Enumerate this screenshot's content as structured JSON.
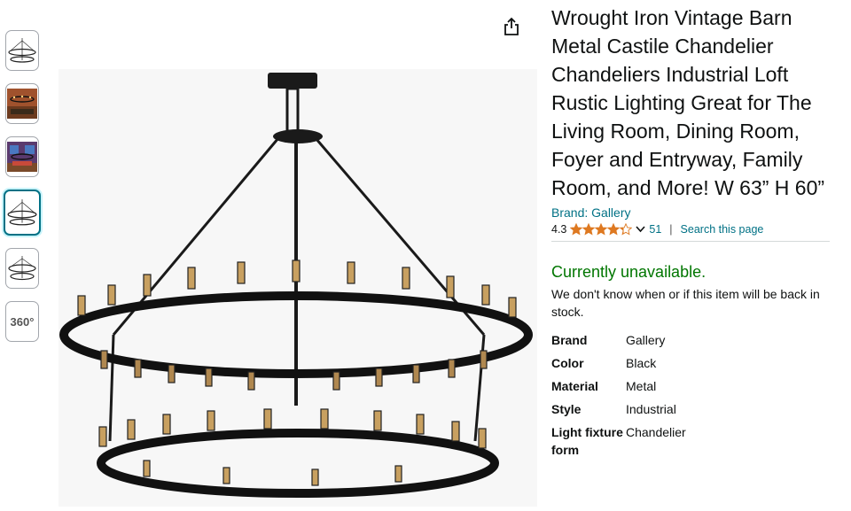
{
  "thumbnails": [
    {
      "name": "thumb-chandelier-1",
      "selected": false
    },
    {
      "name": "thumb-room-scene-1",
      "selected": false
    },
    {
      "name": "thumb-room-scene-2",
      "selected": false
    },
    {
      "name": "thumb-chandelier-2",
      "selected": true
    },
    {
      "name": "thumb-chandelier-3",
      "selected": false
    },
    {
      "name": "thumb-360",
      "selected": false
    }
  ],
  "thumb_360_label": "360°",
  "share_icon": "share-icon",
  "product": {
    "title": "Wrought Iron Vintage Barn Metal Castile Chandelier Chandeliers Industrial Loft Rustic Lighting Great for The Living Room, Dining Room, Foyer and Entryway, Family Room, and More! W 63” H 60”",
    "brand_link": "Brand: Gallery",
    "rating": "4.3",
    "rating_value": 4.3,
    "rating_max": 5,
    "review_count": "51",
    "separator": "|",
    "search_link": "Search this page",
    "availability": "Currently unavailable.",
    "availability_note": "We don't know when or if this item will be back in stock."
  },
  "specs": [
    {
      "key": "Brand",
      "value": "Gallery"
    },
    {
      "key": "Color",
      "value": "Black"
    },
    {
      "key": "Material",
      "value": "Metal"
    },
    {
      "key": "Style",
      "value": "Industrial"
    },
    {
      "key": "Light fixture form",
      "value": "Chandelier"
    }
  ],
  "colors": {
    "link": "#007185",
    "available_green": "#007600",
    "star": "#de7921",
    "selected_border": "#007185"
  }
}
